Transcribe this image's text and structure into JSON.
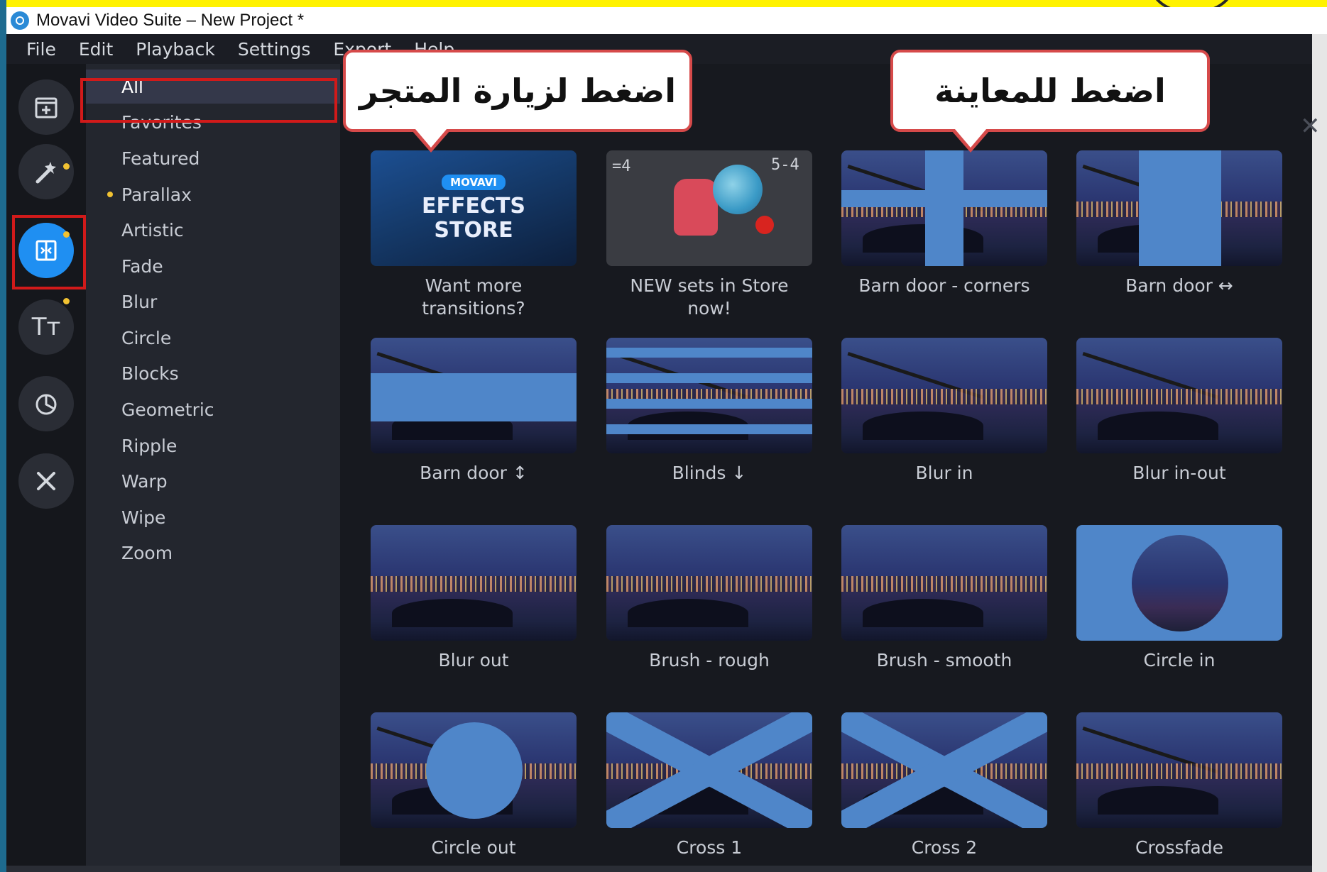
{
  "window": {
    "title": "Movavi Video Suite – New Project *"
  },
  "menu": [
    "File",
    "Edit",
    "Playback",
    "Settings",
    "Export",
    "Help"
  ],
  "tools": [
    {
      "icon": "import-icon"
    },
    {
      "icon": "magic-wand-icon"
    },
    {
      "icon": "transitions-icon",
      "active": true
    },
    {
      "icon": "titles-icon",
      "glyph": "Tт"
    },
    {
      "icon": "stickers-icon"
    },
    {
      "icon": "tools-icon"
    }
  ],
  "categories": [
    "All",
    "Favorites",
    "Featured",
    "Parallax",
    "Artistic",
    "Fade",
    "Blur",
    "Circle",
    "Blocks",
    "Geometric",
    "Ripple",
    "Warp",
    "Wipe",
    "Zoom"
  ],
  "search": {
    "close_glyph": "✕"
  },
  "store_tile": {
    "badge": "MOVAVI",
    "line1": "EFFECTS",
    "line2": "STORE"
  },
  "newsets_tile": {
    "chalk1": "5-4",
    "chalk2": "=4"
  },
  "tiles": [
    "Want more transitions?",
    "NEW sets in Store now!",
    "Barn door - corners",
    "Barn door ↔",
    "Barn door ↕",
    "Blinds ↓",
    "Blur in",
    "Blur in-out",
    "Blur out",
    "Brush - rough",
    "Brush - smooth",
    "Circle in",
    "Circle out",
    "Cross 1",
    "Cross 2",
    "Crossfade"
  ],
  "callouts": {
    "store": "اضغط لزيارة المتجر",
    "preview": "اضغط للمعاينة"
  },
  "colors": {
    "accent": "#1f8ff2",
    "highlight": "#d11a1a",
    "badge_dot": "#f1c232"
  }
}
